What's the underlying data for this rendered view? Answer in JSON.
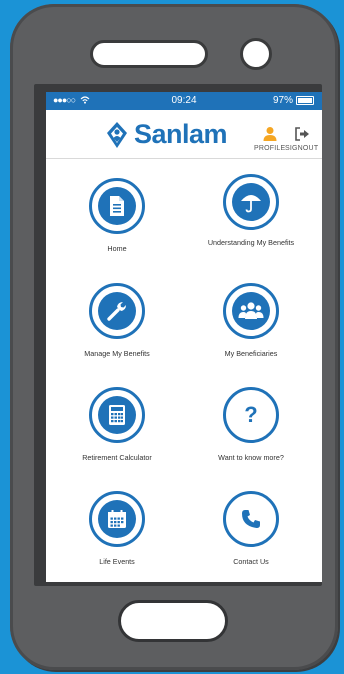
{
  "status": {
    "signal": "●●●○○",
    "time": "09:24",
    "battery": "97%"
  },
  "brand": {
    "name": "Sanlam"
  },
  "header": {
    "profile_label": "PROFILE",
    "signout_label": "SIGNOUT"
  },
  "tiles": [
    {
      "label": "Home",
      "icon": "document-icon"
    },
    {
      "label": "Understanding My Benefits",
      "icon": "umbrella-icon"
    },
    {
      "label": "Manage My Benefits",
      "icon": "wrench-icon"
    },
    {
      "label": "My Beneficiaries",
      "icon": "group-icon"
    },
    {
      "label": "Retirement Calculator",
      "icon": "calculator-icon"
    },
    {
      "label": "Want to know more?",
      "icon": "question-icon"
    },
    {
      "label": "Life Events",
      "icon": "calendar-icon"
    },
    {
      "label": "Contact Us",
      "icon": "phone-icon"
    }
  ],
  "colors": {
    "brand_blue": "#1f72b8",
    "background": "#1b93d6",
    "phone_body": "#5d5e60"
  }
}
